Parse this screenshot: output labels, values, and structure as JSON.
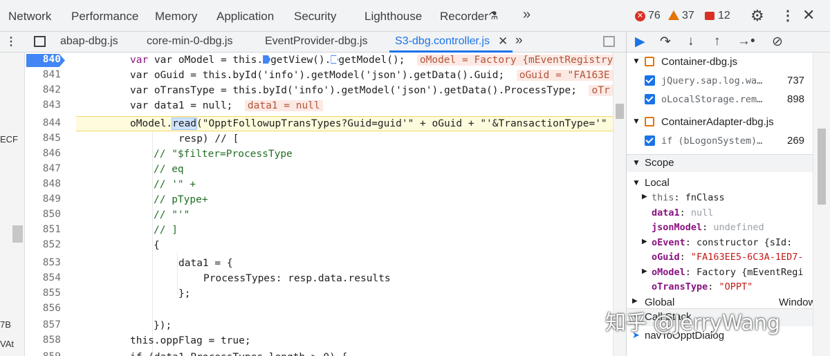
{
  "devtools_tabs": [
    "Network",
    "Performance",
    "Memory",
    "Application",
    "Security",
    "Lighthouse",
    "Recorder"
  ],
  "more_tabs_label": "»",
  "status": {
    "errors": "76",
    "warnings": "37",
    "issues": "12"
  },
  "file_tabs": [
    "abap-dbg.js",
    "core-min-0-dbg.js",
    "EventProvider-dbg.js",
    "S3-dbg.controller.js"
  ],
  "active_file": "S3-dbg.controller.js",
  "left_strip": [
    "ECF",
    "7B",
    "VAt"
  ],
  "line_numbers": [
    "840",
    "841",
    "842",
    "843",
    "844",
    "845",
    "846",
    "847",
    "848",
    "849",
    "850",
    "851",
    "852",
    "853",
    "854",
    "855",
    "856",
    "857",
    "858",
    "859"
  ],
  "code": {
    "l840_a": "var oModel = this.",
    "l840_b": "getView().",
    "l840_c": "getModel();",
    "l840_inline": "oModel = Factory {mEventRegistry: {",
    "l841": "var oGuid = this.byId('info').getModel('json').getData().Guid;",
    "l841_inline": "oGuid = \"FA163E",
    "l842": "var oTransType = this.byId('info').getModel('json').getData().ProcessType;",
    "l842_inline": "oTr",
    "l843": "var data1 = null;",
    "l843_inline": "data1 = null",
    "l844_a": "oModel.",
    "l844_b": "read",
    "l844_c": "(\"OpptFollowupTransTypes?Guid=guid'\" + oGuid + \"'&TransactionType='\"",
    "l845": "resp) // [",
    "l846": "// \"$filter=ProcessType",
    "l847": "// eq",
    "l848": "// '\" +",
    "l849": "// pType+",
    "l850": "// \"'\"",
    "l851": "// ]",
    "l852": "{",
    "l853": "data1 = {",
    "l854": "ProcessTypes: resp.data.results",
    "l855": "};",
    "l856": "",
    "l857": "});",
    "l858": "this.oppFlag = true;",
    "l859": "if (data1.ProcessTypes.length > 0) {"
  },
  "sidebar": {
    "bp_groups": [
      {
        "file": "Container-dbg.js",
        "items": [
          {
            "code": "jQuery.sap.log.wa…",
            "line": "737"
          },
          {
            "code": "oLocalStorage.rem…",
            "line": "898"
          }
        ]
      },
      {
        "file": "ContainerAdapter-dbg.js",
        "items": [
          {
            "code": "if (bLogonSystem)…",
            "line": "269"
          }
        ]
      }
    ],
    "scope_label": "Scope",
    "local_label": "Local",
    "local_vars": [
      {
        "k": "this",
        "v": "fnClass",
        "type": "obj",
        "expand": true
      },
      {
        "k": "data1",
        "v": "null",
        "type": "null",
        "expand": false
      },
      {
        "k": "jsonModel",
        "v": "undefined",
        "type": "null",
        "expand": false
      },
      {
        "k": "oEvent",
        "v": "constructor {sId:",
        "type": "obj",
        "expand": true
      },
      {
        "k": "oGuid",
        "v": "\"FA163EE5-6C3A-1ED7-",
        "type": "str",
        "expand": false
      },
      {
        "k": "oModel",
        "v": "Factory {mEventRegi",
        "type": "obj",
        "expand": true
      },
      {
        "k": "oTransType",
        "v": "\"OPPT\"",
        "type": "str",
        "expand": false
      }
    ],
    "global_label": "Global",
    "global_value": "Window",
    "callstack_label": "Call Stack",
    "callstack_first": "navToOpptDialog"
  },
  "watermark": "知乎 @JerryWang",
  "colors": {
    "accent": "#1a73e8",
    "error": "#d93025",
    "warning": "#e37400",
    "issue": "#d93025"
  }
}
